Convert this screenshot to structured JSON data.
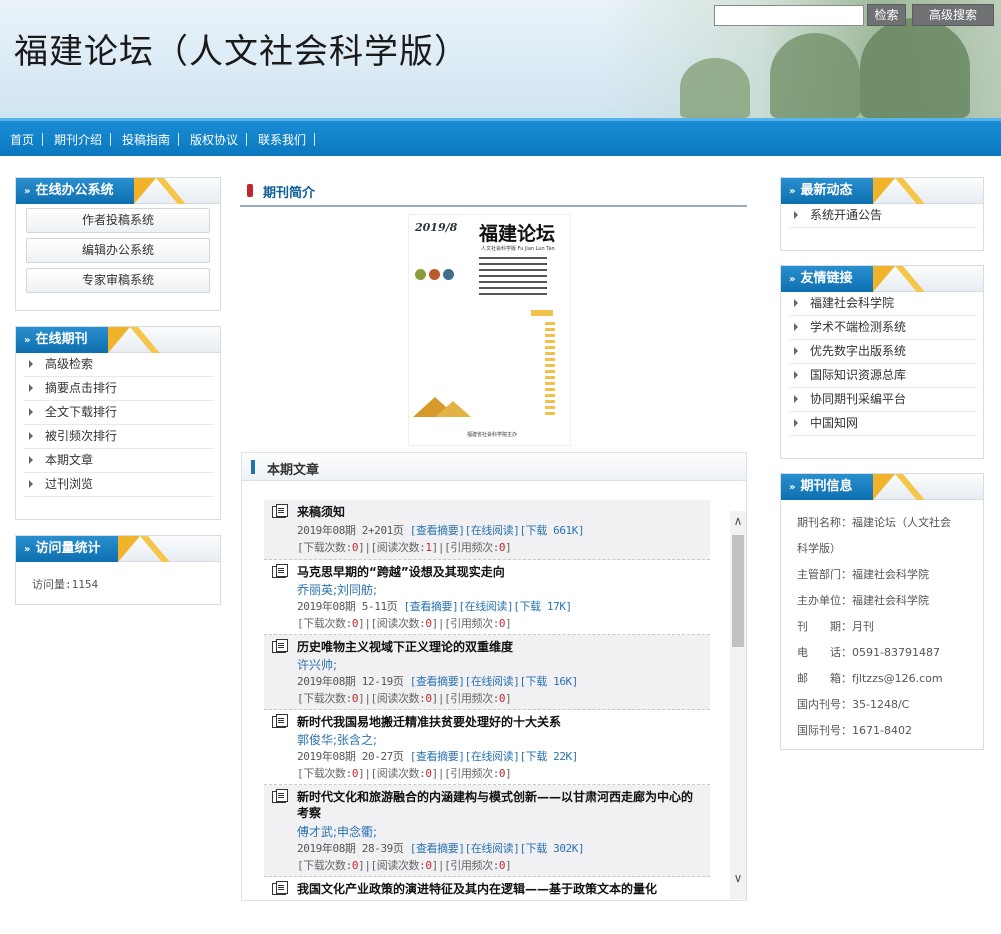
{
  "header": {
    "site_title": "福建论坛（人文社会科学版）",
    "search_placeholder": "",
    "search_button": "检索",
    "advanced_search_button": "高级搜索"
  },
  "nav": [
    "首页",
    "期刊介绍",
    "投稿指南",
    "版权协议",
    "联系我们"
  ],
  "left": {
    "office": {
      "title": "在线办公系统",
      "buttons": [
        "作者投稿系统",
        "编辑办公系统",
        "专家审稿系统"
      ]
    },
    "journal": {
      "title": "在线期刊",
      "items": [
        "高级检索",
        "摘要点击排行",
        "全文下载排行",
        "被引频次排行",
        "本期文章",
        "过刊浏览"
      ]
    },
    "visits": {
      "title": "访问量统计",
      "text": "访问量:1154"
    }
  },
  "center": {
    "intro_title": "期刊简介",
    "cover": {
      "year": "2019/8",
      "title": "福建论坛",
      "subtitle": "人文社会科学版 Fu Jian Lun Tan",
      "publisher": "福建省社会科学院主办"
    },
    "articles_title": "本期文章",
    "articles": [
      {
        "title": "来稿须知",
        "author": "",
        "issue": "2019年08期",
        "pages": "2+201页",
        "view_abstract": "[查看摘要]",
        "read_online": "[在线阅读]",
        "download": "[下载 661K]",
        "downloads_label": "[下载次数:",
        "downloads": "0",
        "reads_label": "]|[阅读次数:",
        "reads": "1",
        "cites_label": "]|[引用频次:",
        "cites": "0",
        "end": "]"
      },
      {
        "title": "马克思早期的“跨越”设想及其现实走向",
        "author": "乔丽英;刘同舫;",
        "issue": "2019年08期",
        "pages": "5-11页",
        "view_abstract": "[查看摘要]",
        "read_online": "[在线阅读]",
        "download": "[下载 17K]",
        "downloads_label": "[下载次数:",
        "downloads": "0",
        "reads_label": "]|[阅读次数:",
        "reads": "0",
        "cites_label": "]|[引用频次:",
        "cites": "0",
        "end": "]"
      },
      {
        "title": "历史唯物主义视域下正义理论的双重维度",
        "author": "许兴帅;",
        "issue": "2019年08期",
        "pages": "12-19页",
        "view_abstract": "[查看摘要]",
        "read_online": "[在线阅读]",
        "download": "[下载 16K]",
        "downloads_label": "[下载次数:",
        "downloads": "0",
        "reads_label": "]|[阅读次数:",
        "reads": "0",
        "cites_label": "]|[引用频次:",
        "cites": "0",
        "end": "]"
      },
      {
        "title": "新时代我国易地搬迁精准扶贫要处理好的十大关系",
        "author": "郭俊华;张含之;",
        "issue": "2019年08期",
        "pages": "20-27页",
        "view_abstract": "[查看摘要]",
        "read_online": "[在线阅读]",
        "download": "[下载 22K]",
        "downloads_label": "[下载次数:",
        "downloads": "0",
        "reads_label": "]|[阅读次数:",
        "reads": "0",
        "cites_label": "]|[引用频次:",
        "cites": "0",
        "end": "]"
      },
      {
        "title": "新时代文化和旅游融合的内涵建构与模式创新——以甘肃河西走廊为中心的考察",
        "author": "傅才武;申念衢;",
        "issue": "2019年08期",
        "pages": "28-39页",
        "view_abstract": "[查看摘要]",
        "read_online": "[在线阅读]",
        "download": "[下载 302K]",
        "downloads_label": "[下载次数:",
        "downloads": "0",
        "reads_label": "]|[阅读次数:",
        "reads": "0",
        "cites_label": "]|[引用频次:",
        "cites": "0",
        "end": "]"
      },
      {
        "title": "我国文化产业政策的演进特征及其内在逻辑——基于政策文本的量化"
      }
    ]
  },
  "right": {
    "news": {
      "title": "最新动态",
      "items": [
        "系统开通公告"
      ]
    },
    "links": {
      "title": "友情链接",
      "items": [
        "福建社会科学院",
        "学术不端检测系统",
        "优先数字出版系统",
        "国际知识资源总库",
        "协同期刊采编平台",
        "中国知网"
      ]
    },
    "info": {
      "title": "期刊信息",
      "lines": [
        "期刊名称：福建论坛（人文社会",
        "科学版）",
        "主管部门：福建社会科学院",
        "主办单位：福建社会科学院",
        "刊　　期：月刊",
        "电　　话：0591-83791487",
        "邮　　箱：fjltzzs@126.com",
        "国内刊号：35-1248/C",
        "国际刊号：1671-8402"
      ]
    }
  }
}
